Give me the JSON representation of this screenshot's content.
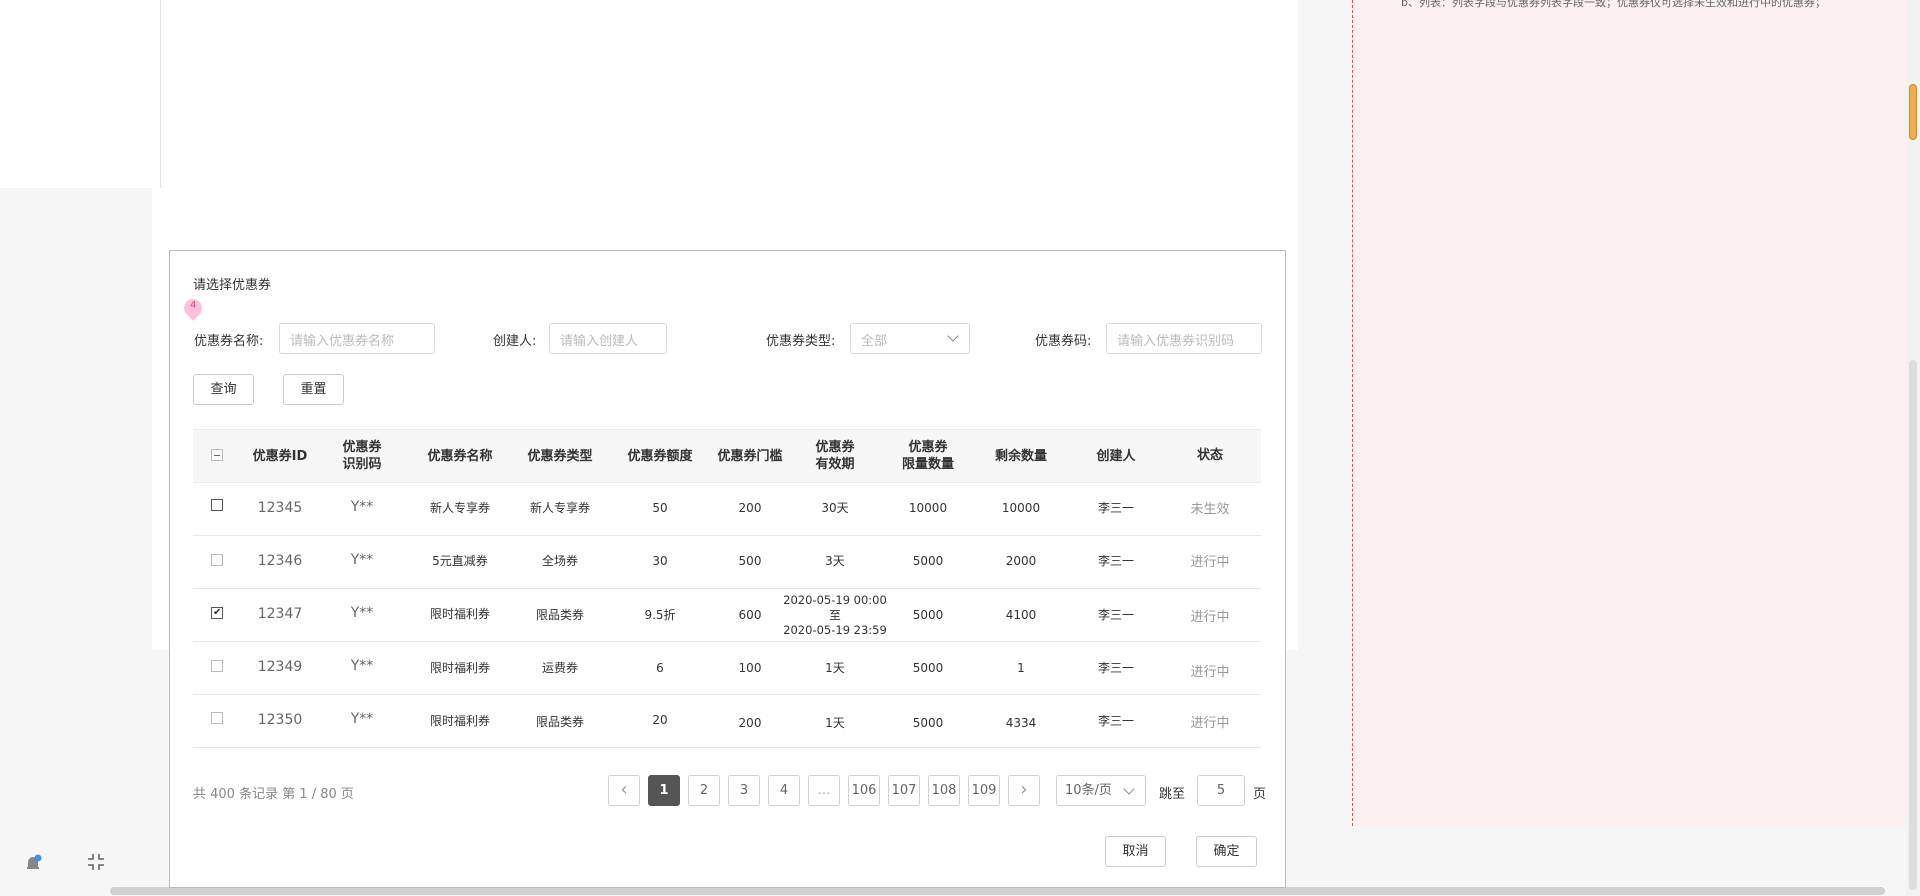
{
  "note": {
    "text": "b、列表：列表字段与优惠券列表字段一致；优惠券仅可选择未生效和进行中的优惠券；"
  },
  "dialog": {
    "title": "请选择优惠券",
    "badge": "4",
    "filters": {
      "name_label": "优惠券名称:",
      "name_placeholder": "请输入优惠券名称",
      "creator_label": "创建人:",
      "creator_placeholder": "请输入创建人",
      "type_label": "优惠券类型:",
      "type_value": "全部",
      "code_label": "优惠券码:",
      "code_placeholder": "请输入优惠券识别码"
    },
    "buttons": {
      "query": "查询",
      "reset": "重置",
      "cancel": "取消",
      "confirm": "确定"
    },
    "columns": [
      "优惠券ID",
      "优惠券\n识别码",
      "优惠券名称",
      "优惠券类型",
      "优惠券额度",
      "优惠券门槛",
      "优惠券\n有效期",
      "优惠券\n限量数量",
      "剩余数量",
      "创建人",
      "状态"
    ],
    "rows": [
      {
        "checked": false,
        "id": "12345",
        "code": "Y**",
        "name": "新人专享券",
        "type": "新人专享券",
        "amount": "50",
        "threshold": "200",
        "validity": "30天",
        "limit": "10000",
        "remaining": "10000",
        "creator": "李三一",
        "status": "未生效"
      },
      {
        "checked": false,
        "id": "12346",
        "code": "Y**",
        "name": "5元直减券",
        "type": "全场券",
        "amount": "30",
        "threshold": "500",
        "validity": "3天",
        "limit": "5000",
        "remaining": "2000",
        "creator": "李三一",
        "status": "进行中"
      },
      {
        "checked": true,
        "id": "12347",
        "code": "Y**",
        "name": "限时福利券",
        "type": "限品类券",
        "amount": "9.5折",
        "threshold": "600",
        "validity": "2020-05-19 00:00\n至\n2020-05-19 23:59",
        "limit": "5000",
        "remaining": "4100",
        "creator": "李三一",
        "status": "进行中"
      },
      {
        "checked": false,
        "id": "12349",
        "code": "Y**",
        "name": "限时福利券",
        "type": "运费券",
        "amount": "6",
        "threshold": "100",
        "validity": "1天",
        "limit": "5000",
        "remaining": "1",
        "creator": "李三一",
        "status": "进行中"
      },
      {
        "checked": false,
        "id": "12350",
        "code": "Y**",
        "name": "限时福利券",
        "type": "限品类券",
        "amount": "20",
        "threshold": "200",
        "validity": "1天",
        "limit": "5000",
        "remaining": "4334",
        "creator": "李三一",
        "status": "进行中"
      }
    ],
    "pagination": {
      "summary": "共 400 条记录 第 1 / 80 页",
      "pages": [
        "1",
        "2",
        "3",
        "4",
        "...",
        "106",
        "107",
        "108",
        "109"
      ],
      "current": "1",
      "page_size": "10条/页",
      "jump_label": "跳至",
      "jump_value": "5",
      "jump_suffix": "页"
    }
  },
  "colors": {
    "accent": "#555555",
    "note_bg": "#fdf0f0",
    "note_border": "#d9534f",
    "badge": "#ffc1dd"
  }
}
